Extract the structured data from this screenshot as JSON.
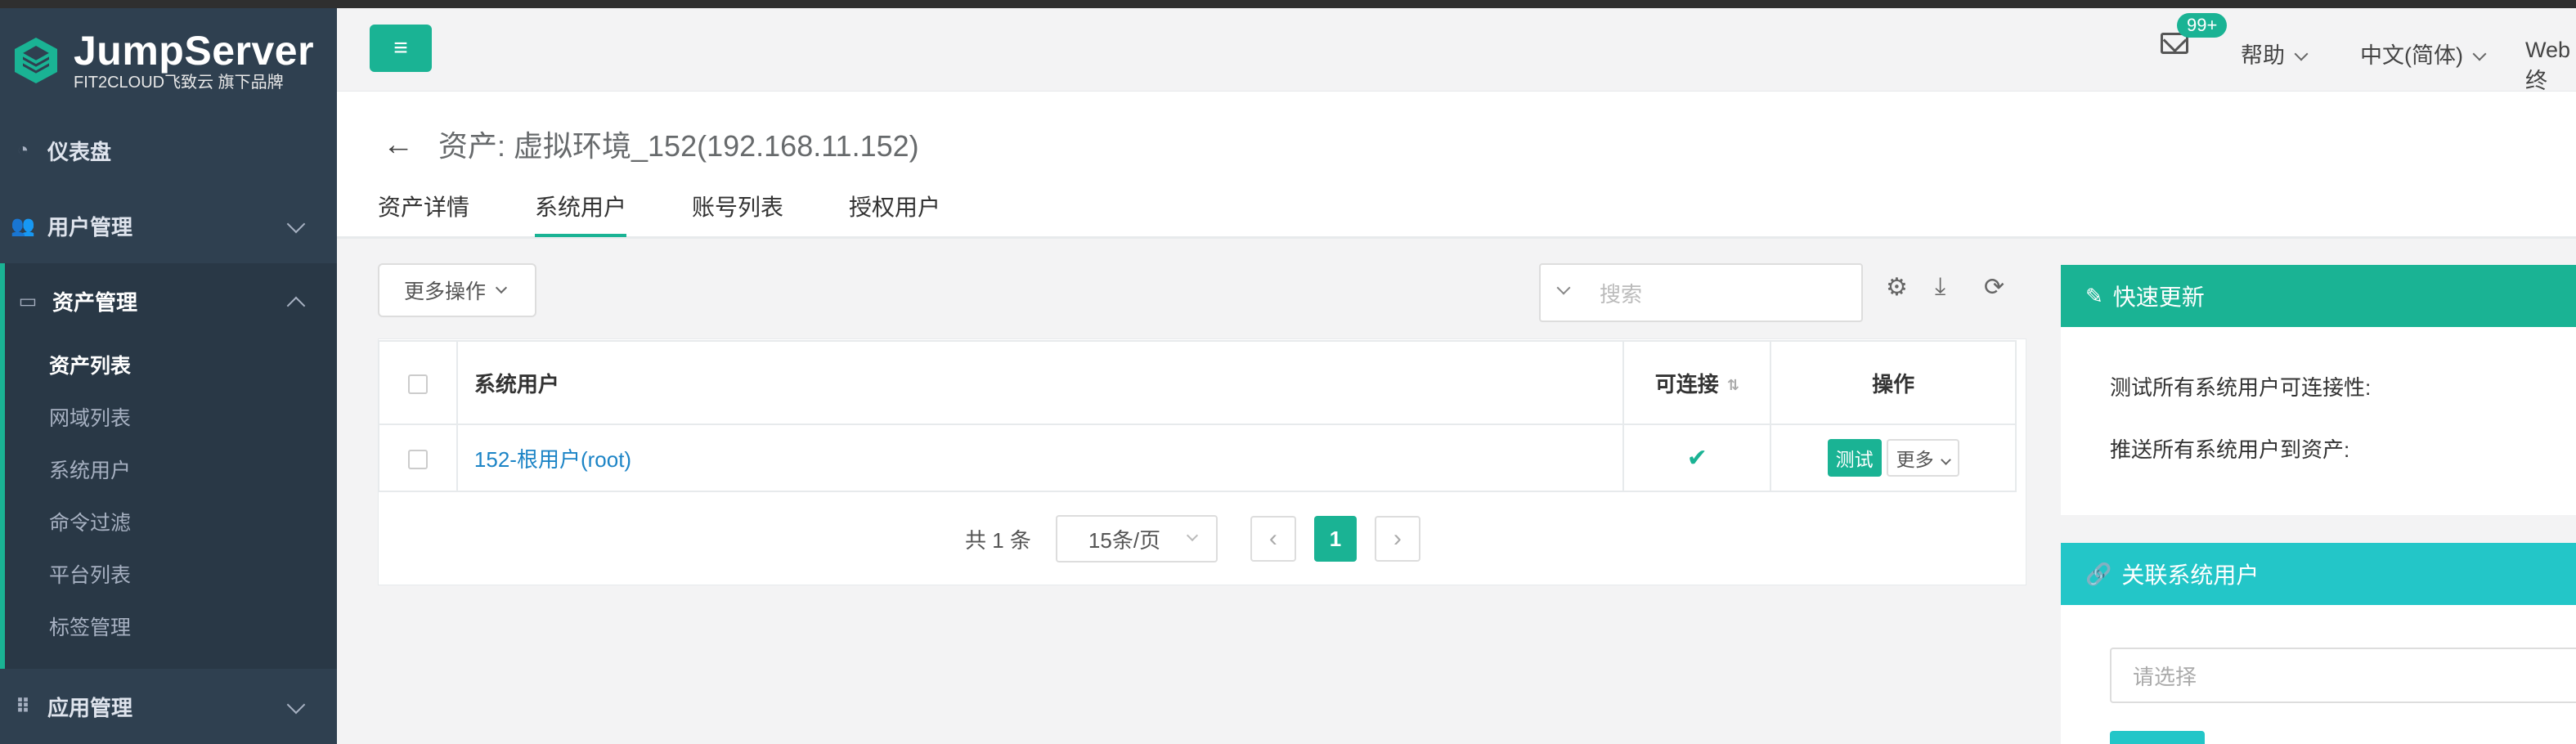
{
  "brand": {
    "title": "JumpServer",
    "subtitle": "FIT2CLOUD飞致云 旗下品牌"
  },
  "sidebar": {
    "items": [
      {
        "label": "仪表盘",
        "icon": "dashboard-icon"
      },
      {
        "label": "用户管理",
        "icon": "users-icon"
      },
      {
        "label": "资产管理",
        "icon": "inbox-icon"
      },
      {
        "label": "应用管理",
        "icon": "grid-icon"
      }
    ],
    "asset_sub": [
      "资产列表",
      "网域列表",
      "系统用户",
      "命令过滤",
      "平台列表",
      "标签管理"
    ]
  },
  "header": {
    "badge": "99+",
    "help": "帮助",
    "lang": "中文(简体)",
    "web": "Web终"
  },
  "page": {
    "back": "←",
    "title": "资产: 虚拟环境_152(192.168.11.152)",
    "tabs": [
      "资产详情",
      "系统用户",
      "账号列表",
      "授权用户"
    ]
  },
  "toolbar": {
    "more_ops": "更多操作",
    "search_placeholder": "搜索"
  },
  "table": {
    "headers": [
      "系统用户",
      "可连接",
      "操作"
    ],
    "rows": [
      {
        "name": "152-根用户(root)",
        "connectable": "✔",
        "test": "测试",
        "more": "更多"
      }
    ]
  },
  "pager": {
    "total": "共 1 条",
    "page_size": "15条/页",
    "current": "1"
  },
  "quick_update": {
    "title": "快速更新",
    "line1": "测试所有系统用户可连接性:",
    "line2": "推送所有系统用户到资产:"
  },
  "assoc": {
    "title": "关联系统用户",
    "placeholder": "请选择"
  },
  "colors": {
    "primary": "#1ab394",
    "info": "#23c6c8",
    "sidebar": "#2f4050",
    "link": "#1c84c6"
  }
}
